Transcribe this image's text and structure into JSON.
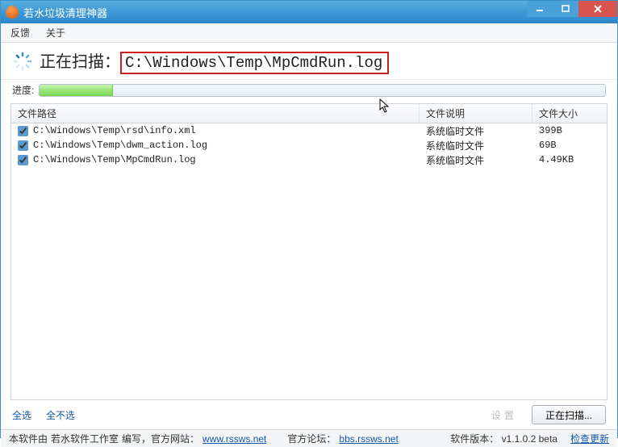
{
  "window": {
    "title": "若水垃圾清理神器"
  },
  "menu": {
    "feedback": "反馈",
    "about": "关于"
  },
  "scan": {
    "label_prefix": "正在扫描：",
    "path": "C:\\Windows\\Temp\\MpCmdRun.log"
  },
  "progress": {
    "label": "进度:",
    "percent": 13
  },
  "table": {
    "headers": {
      "path": "文件路径",
      "desc": "文件说明",
      "size": "文件大小"
    },
    "rows": [
      {
        "checked": true,
        "path": "C:\\Windows\\Temp\\rsd\\info.xml",
        "desc": "系统临时文件",
        "size": "399B"
      },
      {
        "checked": true,
        "path": "C:\\Windows\\Temp\\dwm_action.log",
        "desc": "系统临时文件",
        "size": "69B"
      },
      {
        "checked": true,
        "path": "C:\\Windows\\Temp\\MpCmdRun.log",
        "desc": "系统临时文件",
        "size": "4.49KB"
      }
    ]
  },
  "actions": {
    "select_all": "全选",
    "select_none": "全不选",
    "faint_label": "设置",
    "scan_button": "正在扫描..."
  },
  "footer": {
    "prefix": "本软件由",
    "studio": "若水软件工作室",
    "written": "编写，官方网站：",
    "site": "www.rssws.net",
    "forum_label": "官方论坛：",
    "forum": "bbs.rssws.net",
    "version_label": "软件版本：",
    "version": "v1.1.0.2 beta",
    "check_update": "检查更新"
  }
}
